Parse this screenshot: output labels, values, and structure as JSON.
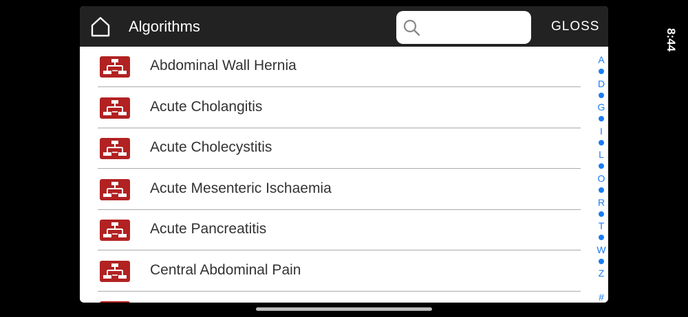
{
  "status": {
    "time": "8:44"
  },
  "header": {
    "title": "Algorithms",
    "search_placeholder": "",
    "gloss_label": "GLOSS"
  },
  "list": {
    "items": [
      {
        "label": "Abdominal Wall Hernia"
      },
      {
        "label": "Acute Cholangitis"
      },
      {
        "label": "Acute Cholecystitis"
      },
      {
        "label": "Acute Mesenteric Ischaemia"
      },
      {
        "label": "Acute Pancreatitis"
      },
      {
        "label": "Central Abdominal Pain"
      }
    ]
  },
  "index": {
    "letters": [
      "A",
      "D",
      "G",
      "I",
      "L",
      "O",
      "R",
      "T",
      "W",
      "Z",
      "#"
    ]
  },
  "colors": {
    "header_bg": "#222222",
    "icon_red": "#b22222",
    "index_blue": "#1a7cf5"
  },
  "icons": {
    "home": "home-icon",
    "search": "search-icon",
    "algorithm": "flowchart-icon"
  }
}
